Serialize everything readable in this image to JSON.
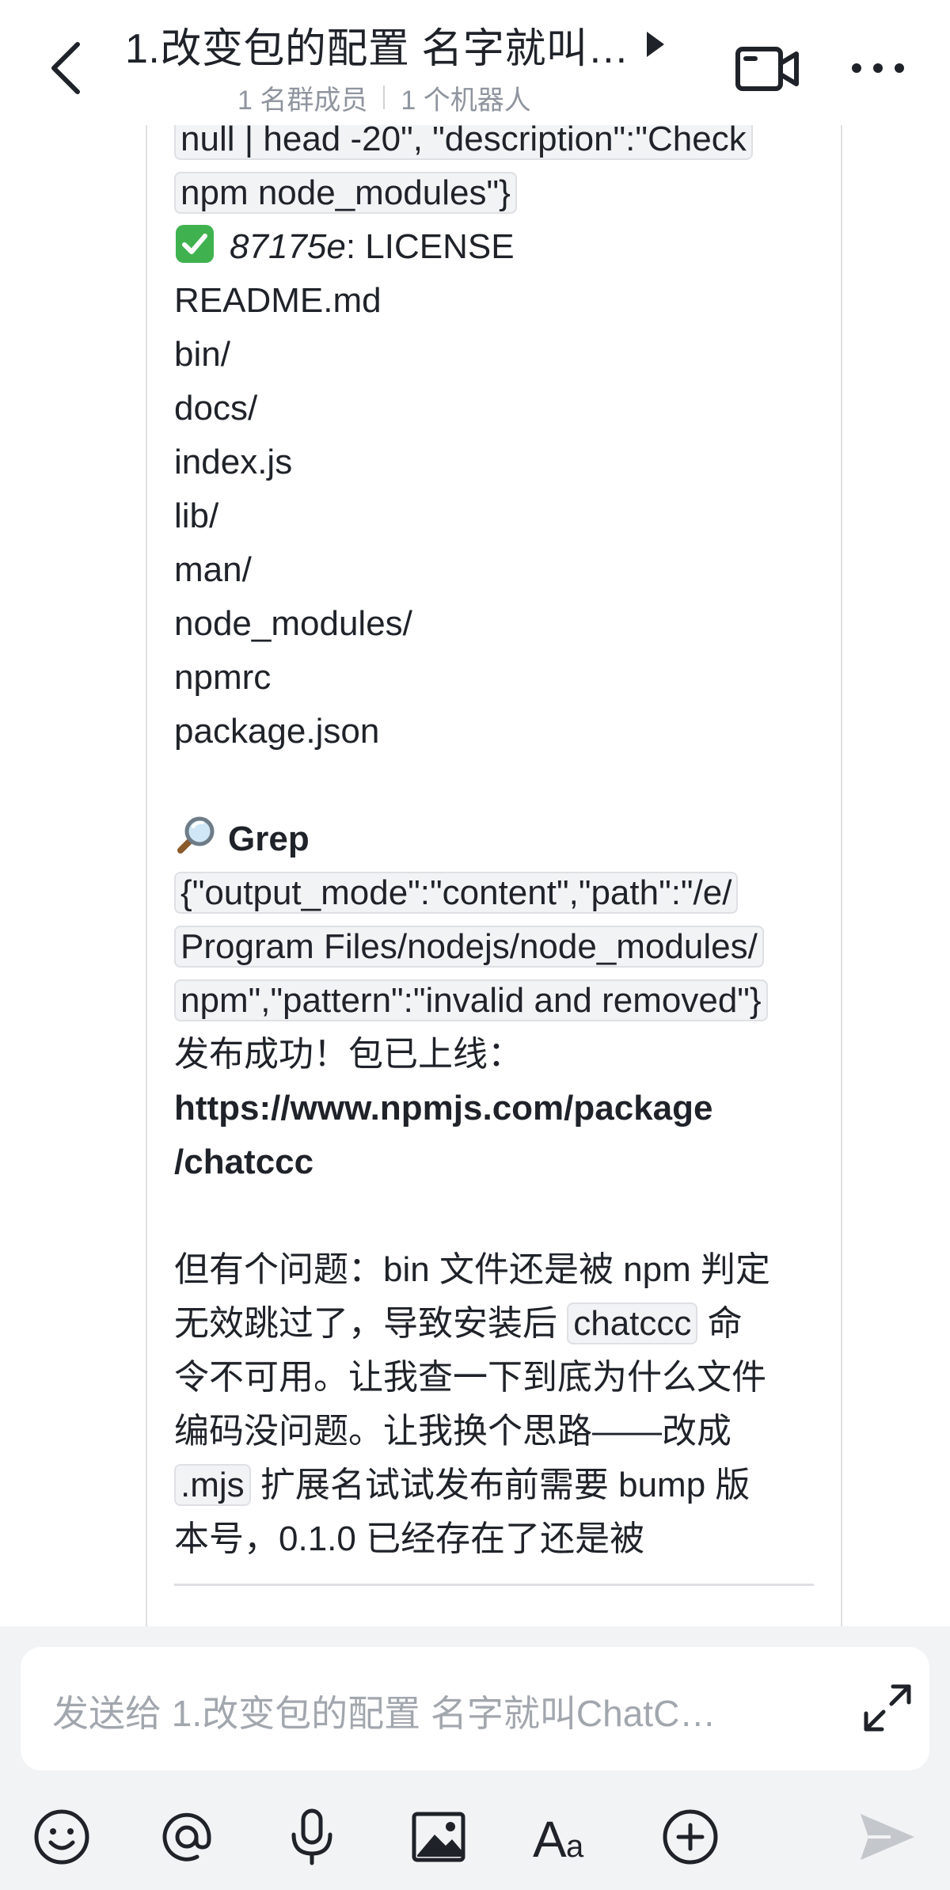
{
  "header": {
    "title": "1.改变包的配置 名字就叫…",
    "members": "1 名群成员",
    "bots": "1 个机器人"
  },
  "message": {
    "lines": [
      {
        "type": "code",
        "text": "null | head -20\", \"description\":\"Check"
      },
      {
        "type": "code",
        "text": "npm node_modules\"}"
      },
      {
        "type": "result",
        "hash": "87175e",
        "rest": ": LICENSE"
      },
      {
        "type": "text",
        "text": "README.md"
      },
      {
        "type": "text",
        "text": "bin/"
      },
      {
        "type": "text",
        "text": "docs/"
      },
      {
        "type": "text",
        "text": "index.js"
      },
      {
        "type": "text",
        "text": "lib/"
      },
      {
        "type": "text",
        "text": "man/"
      },
      {
        "type": "text",
        "text": "node_modules/"
      },
      {
        "type": "text",
        "text": "npmrc"
      },
      {
        "type": "text",
        "text": "package.json"
      },
      {
        "type": "blank"
      },
      {
        "type": "tool",
        "text": "Grep"
      },
      {
        "type": "code",
        "text": "{\"output_mode\":\"content\",\"path\":\"/e/"
      },
      {
        "type": "code",
        "text": "Program Files/nodejs/node_modules/"
      },
      {
        "type": "code",
        "text": "npm\",\"pattern\":\"invalid and removed\"}"
      },
      {
        "type": "text",
        "text": "发布成功！包已上线："
      },
      {
        "type": "bold",
        "text": "https://www.npmjs.com/package"
      },
      {
        "type": "bold",
        "text": "/chatccc"
      },
      {
        "type": "blank"
      },
      {
        "type": "text",
        "text": "但有个问题：bin 文件还是被 npm 判定"
      },
      {
        "type": "mixed",
        "before": "无效跳过了，导致安装后 ",
        "code": "chatccc",
        "after": " 命"
      },
      {
        "type": "text",
        "text": "令不可用。让我查一下到底为什么文件"
      },
      {
        "type": "text",
        "text": "编码没问题。让我换个思路——改成"
      },
      {
        "type": "mixed",
        "before": "",
        "code": ".mjs",
        "after": " 扩展名试试发布前需要 bump 版"
      },
      {
        "type": "text",
        "text": "本号，0.1.0 已经存在了还是被"
      }
    ]
  },
  "input": {
    "placeholder": "发送给 1.改变包的配置 名字就叫ChatC…"
  },
  "toolbar": {
    "icons": [
      "emoji-icon",
      "mention-icon",
      "microphone-icon",
      "image-icon",
      "text-format-icon",
      "plus-circle-icon",
      "send-icon"
    ]
  },
  "colors": {
    "text": "#1f2329",
    "muted": "#8f959e",
    "code_bg": "#f2f3f5",
    "border": "#dee0e3",
    "panel_bg": "#f2f3f5",
    "check_green": "#3fb24f"
  }
}
